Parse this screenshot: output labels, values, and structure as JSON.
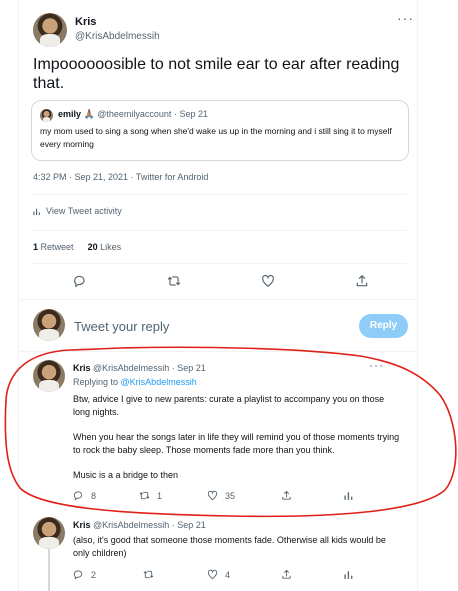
{
  "main_tweet": {
    "author_name": "Kris",
    "author_handle": "@KrisAbdelmessih",
    "text": "Impoooooosible to not smile ear to ear after reading that.",
    "quote": {
      "name": "emily 🙏🏽",
      "handle": "@theemilyaccount",
      "sep": "·",
      "date": "Sep 21",
      "text": "my mom used to sing a song when she'd wake us up in the morning and i still sing it to myself every morning"
    },
    "timestamp": "4:32 PM · Sep 21, 2021 · Twitter for Android",
    "activity_label": "View Tweet activity",
    "retweets_count": "1",
    "retweets_label": "Retweet",
    "likes_count": "20",
    "likes_label": "Likes"
  },
  "reply_box": {
    "placeholder": "Tweet your reply",
    "button_label": "Reply"
  },
  "replies": [
    {
      "author_name": "Kris",
      "author_handle": "@KrisAbdelmessih",
      "sep": "·",
      "date": "Sep 21",
      "replying_prefix": "Replying to",
      "replying_handle": "@KrisAbdelmessih",
      "para1": "Btw, advice I give to new parents: curate a playlist to accompany you on those long nights.",
      "para2": "When you hear the songs later in life they will remind you of those moments trying to rock the baby sleep. Those moments fade more than you think.",
      "para3": "Music is a a bridge to then",
      "reply_count": "8",
      "retweet_count": "1",
      "like_count": "35"
    },
    {
      "author_name": "Kris",
      "author_handle": "@KrisAbdelmessih",
      "sep": "·",
      "date": "Sep 21",
      "text": "(also, it's good that someone those moments fade. Otherwise all kids would be only children)",
      "reply_count": "2",
      "retweet_count": "",
      "like_count": "4"
    }
  ],
  "colors": {
    "accent": "#1d9bf0",
    "reply_button_disabled": "#8ecdf8",
    "annotation": "#e0201a"
  }
}
